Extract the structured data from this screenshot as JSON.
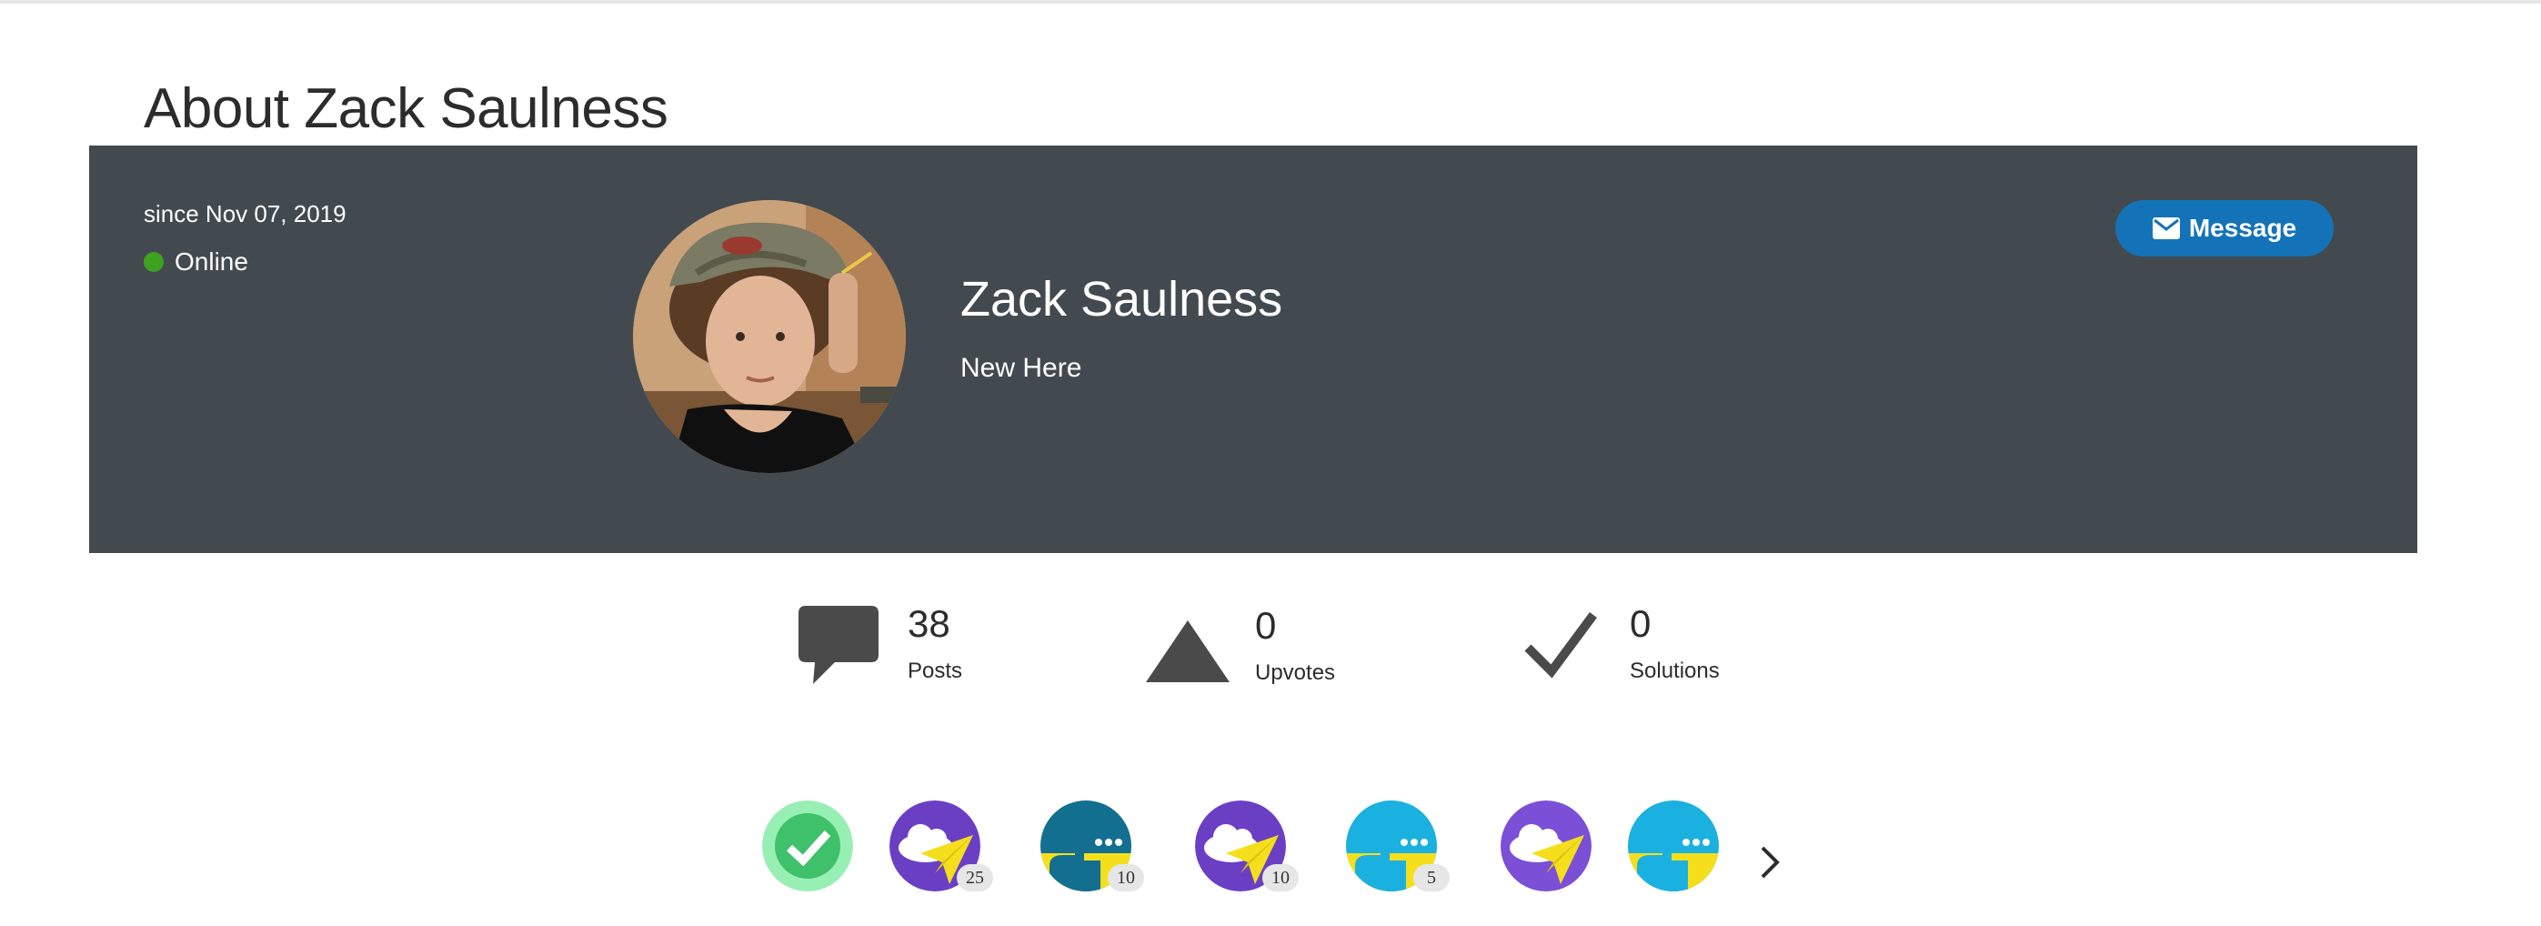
{
  "page": {
    "title": "About Zack Saulness"
  },
  "profile": {
    "since": "since Nov 07, 2019",
    "status": "Online",
    "name": "Zack Saulness",
    "rank": "New Here",
    "message_label": "Message"
  },
  "stats": [
    {
      "value": "38",
      "label": "Posts",
      "icon": "speech-bubble-icon"
    },
    {
      "value": "0",
      "label": "Upvotes",
      "icon": "upvote-triangle-icon"
    },
    {
      "value": "0",
      "label": "Solutions",
      "icon": "checkmark-icon"
    }
  ],
  "badges": [
    {
      "icon": "check-badge-icon",
      "count": ""
    },
    {
      "icon": "paper-plane-cloud-badge-icon",
      "count": "25"
    },
    {
      "icon": "person-chat-badge-icon",
      "count": "10"
    },
    {
      "icon": "paper-plane-cloud-badge-icon",
      "count": "10"
    },
    {
      "icon": "person-chat-badge-icon",
      "count": "5"
    },
    {
      "icon": "paper-plane-cloud-badge-icon",
      "count": ""
    },
    {
      "icon": "person-chat-badge-icon",
      "count": ""
    }
  ],
  "colors": {
    "hero_background": "#434a4f",
    "online_green": "#3ca21f",
    "message_blue": "#1473b8",
    "badge_purple": "#6b3fc4",
    "badge_teal": "#126f8f",
    "badge_cyan": "#1ab0e0",
    "badge_yellow": "#f5df1c",
    "badge_green": "#3fc06a"
  }
}
